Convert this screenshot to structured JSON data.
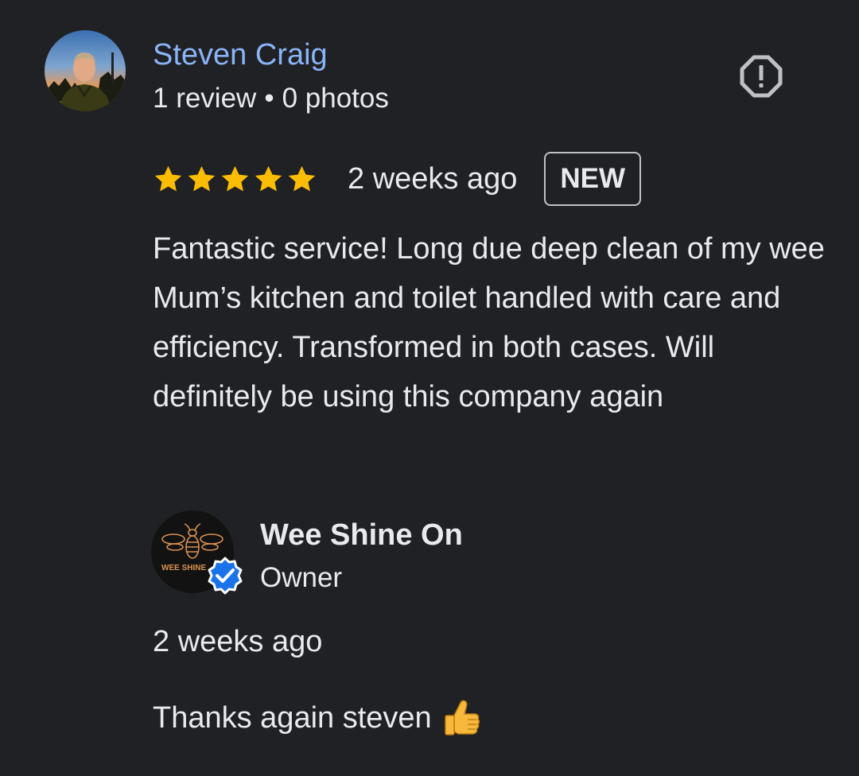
{
  "reviewer": {
    "name": "Steven Craig",
    "review_count": "1 review",
    "separator": "•",
    "photo_count": "0 photos",
    "avatar_icon": "user-photo-avatar"
  },
  "report": {
    "icon": "report-flag-icon"
  },
  "review": {
    "rating": 5,
    "rating_max": 5,
    "date": "2 weeks ago",
    "badge": "NEW",
    "text": "Fantastic service! Long due deep clean of my wee Mum’s kitchen and toilet handled with care and efficiency. Transformed in both cases. Will definitely be using this company again"
  },
  "owner_response": {
    "name": "Wee Shine On",
    "role": "Owner",
    "logo_text": "WEE SHINE",
    "date": "2 weeks ago",
    "text": "Thanks again steven",
    "emoji_icon": "thumbs-up-icon"
  },
  "colors": {
    "background": "#202124",
    "link": "#8ab4f8",
    "text": "#e8eaed",
    "star": "#fbbc04",
    "verified": "#1a73e8",
    "logo_accent": "#d9914f"
  }
}
